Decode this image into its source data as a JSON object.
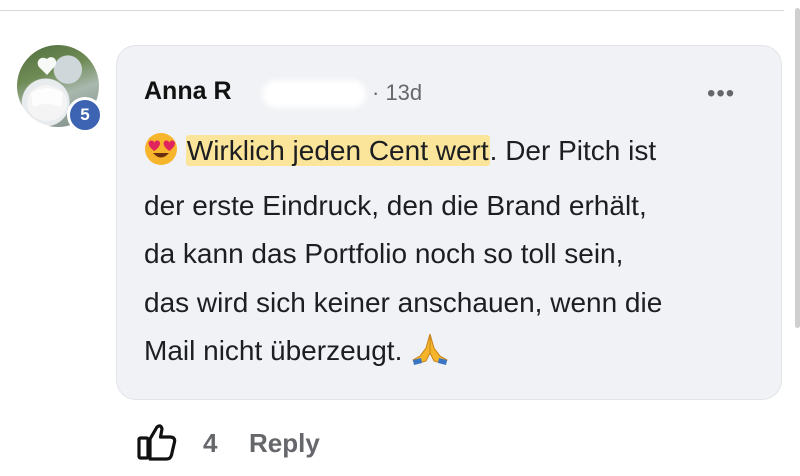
{
  "comment": {
    "author": "Anna R",
    "author_badge_level": "5",
    "timestamp": "· 13d",
    "more_label": "•••",
    "emoji_lead": "heart-eyes-emoji",
    "highlight_text": "Wirklich jeden Cent wert",
    "line1_rest": ". Der Pitch ist",
    "line2": "der erste Eindruck, den die Brand erhält,",
    "line3": "da kann das Portfolio noch so toll sein,",
    "line4": "das wird sich keiner anschauen, wenn die",
    "line5": "Mail nicht überzeugt.",
    "emoji_trail": "folded-hands-emoji",
    "highlight_color": "#fbe59a"
  },
  "actions": {
    "like_icon": "thumbs-up-icon",
    "like_count": "4",
    "reply_label": "Reply"
  }
}
